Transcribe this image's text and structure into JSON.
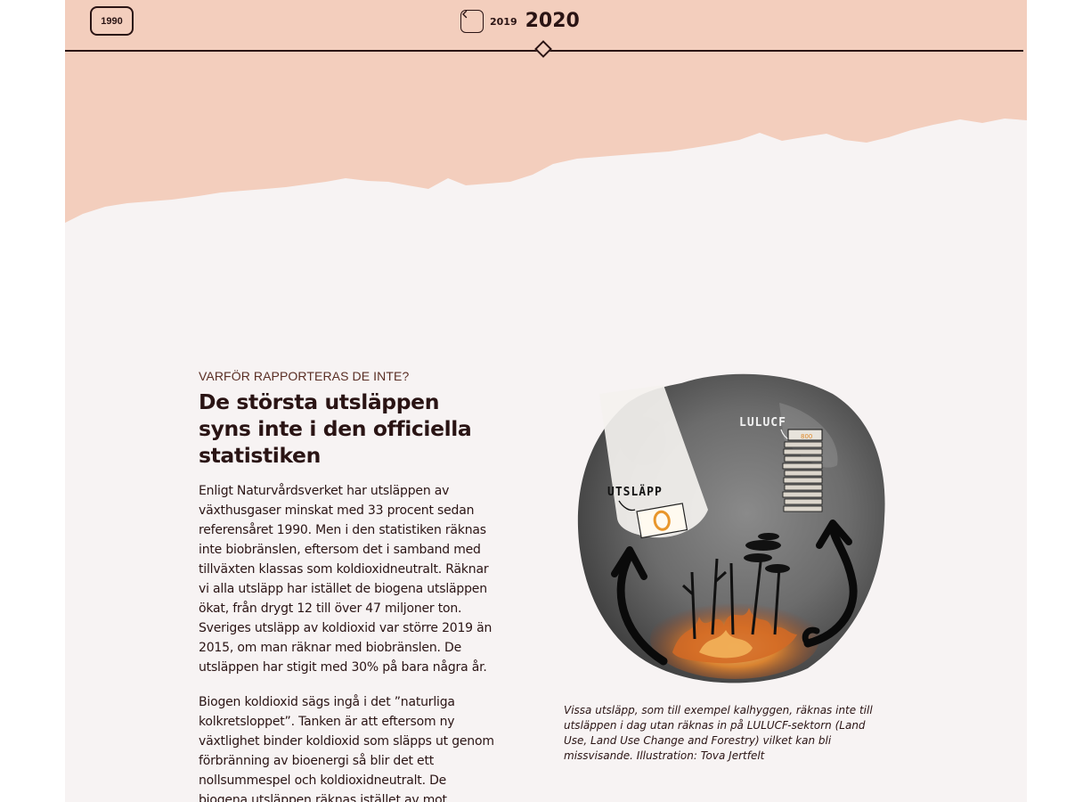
{
  "colors": {
    "peach": "#f3cebd",
    "ink": "#2a1414",
    "paper": "#f7f3f3"
  },
  "timeline": {
    "start_year_label": "1990",
    "prev_icon": "chevron-left-icon",
    "prev_year_label": "2019",
    "current_year_label": "2020"
  },
  "article": {
    "eyebrow": "VARFÖR RAPPORTERAS DE INTE?",
    "headline": "De största utsläppen syns inte i den officiella statistiken",
    "paragraphs": [
      "Enligt Naturvårdsverket har utsläppen av växthusgaser minskat med 33 procent sedan referensåret 1990. Men i den statistiken räknas inte biobränslen, eftersom det i samband med tillväxten klassas som koldioxidneutralt. Räknar vi alla utsläpp har istället de biogena utsläppen ökat, från drygt 12 till över 47 miljoner ton. Sveriges utsläpp av koldioxid var större 2019 än 2015, om man räknar med biobränslen. De utsläppen har stigit med 30% på bara några år.",
      "Biogen koldioxid sägs ingå i det ”naturliga kolkretsloppet”. Tanken är att eftersom ny växtlighet binder koldioxid som släpps ut genom förbränning av bioenergi så blir det ett nollsummespel och koldioxidneutralt. De biogena utsläppen räknas istället av mot"
    ]
  },
  "figure": {
    "label_utslapp": "UTSLÄPP",
    "label_lulucf": "LULUCF",
    "caption": "Vissa utsläpp, som till exempel kalhyggen, räknas inte till utsläppen i dag utan räknas in på LULUCF-sektorn (Land Use, Land Use Change and Forestry) vilket kan bli missvisande. Illustration: Tova Jertfelt"
  }
}
